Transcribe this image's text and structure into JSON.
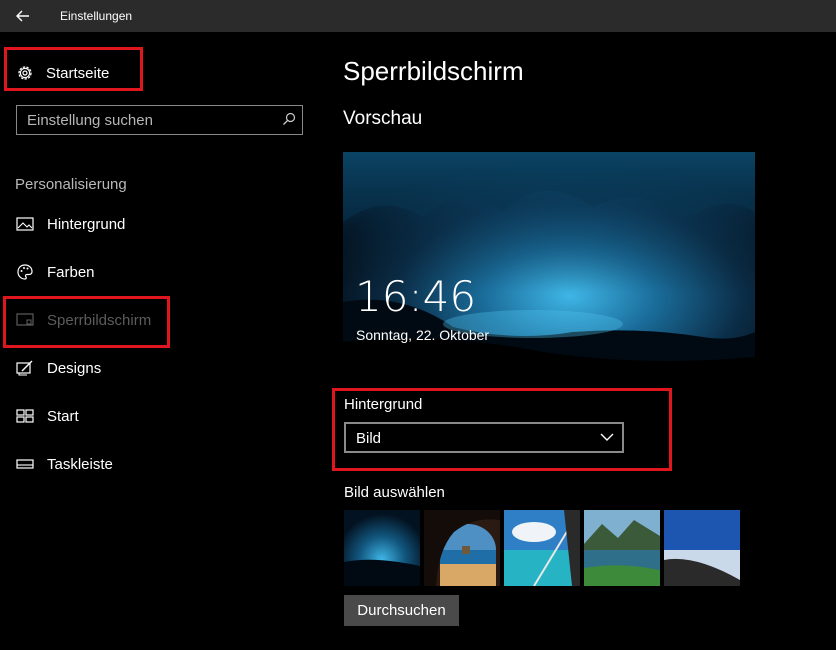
{
  "window": {
    "title": "Einstellungen"
  },
  "sidebar": {
    "home_label": "Startseite",
    "search_placeholder": "Einstellung suchen",
    "section_label": "Personalisierung",
    "items": [
      {
        "label": "Hintergrund",
        "icon": "image-icon"
      },
      {
        "label": "Farben",
        "icon": "palette-icon"
      },
      {
        "label": "Sperrbildschirm",
        "icon": "lock-screen-icon",
        "active": true
      },
      {
        "label": "Designs",
        "icon": "theme-icon"
      },
      {
        "label": "Start",
        "icon": "start-icon"
      },
      {
        "label": "Taskleiste",
        "icon": "taskbar-icon"
      }
    ]
  },
  "main": {
    "title": "Sperrbildschirm",
    "preview_heading": "Vorschau",
    "preview": {
      "time": "16:46",
      "date": "Sonntag, 22. Oktober"
    },
    "background_label": "Hintergrund",
    "background_value": "Bild",
    "pick_label": "Bild auswählen",
    "browse_label": "Durchsuchen"
  },
  "colors": {
    "highlight": "#e0161e",
    "titlebar": "#2b2b2b",
    "button": "#4a4a4a"
  }
}
